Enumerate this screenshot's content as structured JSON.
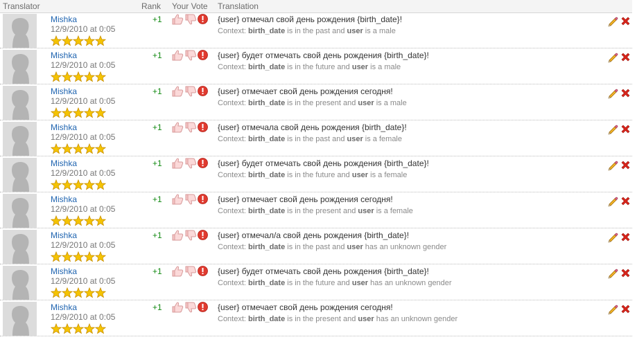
{
  "header": {
    "translator": "Translator",
    "rank": "Rank",
    "your_vote": "Your Vote",
    "translation": "Translation"
  },
  "colors": {
    "link": "#1f64b0",
    "rank": "#138a13",
    "star": "#f5c400",
    "delete": "#d9261c",
    "flag": "#e03a2f"
  },
  "rows": [
    {
      "translator": "Mishka",
      "date": "12/9/2010 at 0:05",
      "stars": 5,
      "rank": "+1",
      "text": "{user} отмечал свой день рождения {birth_date}!",
      "ctx_prefix": "Context: ",
      "ctx_var1": "birth_date",
      "ctx_mid": " is in the past and ",
      "ctx_var2": "user",
      "ctx_suffix": " is a male"
    },
    {
      "translator": "Mishka",
      "date": "12/9/2010 at 0:05",
      "stars": 5,
      "rank": "+1",
      "text": "{user} будет отмечать свой день рождения {birth_date}!",
      "ctx_prefix": "Context: ",
      "ctx_var1": "birth_date",
      "ctx_mid": " is in the future and ",
      "ctx_var2": "user",
      "ctx_suffix": " is a male"
    },
    {
      "translator": "Mishka",
      "date": "12/9/2010 at 0:05",
      "stars": 5,
      "rank": "+1",
      "text": "{user} отмечает свой день рождения сегодня!",
      "ctx_prefix": "Context: ",
      "ctx_var1": "birth_date",
      "ctx_mid": " is in the present and ",
      "ctx_var2": "user",
      "ctx_suffix": " is a male"
    },
    {
      "translator": "Mishka",
      "date": "12/9/2010 at 0:05",
      "stars": 5,
      "rank": "+1",
      "text": "{user} отмечала свой день рождения {birth_date}!",
      "ctx_prefix": "Context: ",
      "ctx_var1": "birth_date",
      "ctx_mid": " is in the past and ",
      "ctx_var2": "user",
      "ctx_suffix": " is a female"
    },
    {
      "translator": "Mishka",
      "date": "12/9/2010 at 0:05",
      "stars": 5,
      "rank": "+1",
      "text": "{user} будет отмечать свой день рождения {birth_date}!",
      "ctx_prefix": "Context: ",
      "ctx_var1": "birth_date",
      "ctx_mid": " is in the future and ",
      "ctx_var2": "user",
      "ctx_suffix": " is a female"
    },
    {
      "translator": "Mishka",
      "date": "12/9/2010 at 0:05",
      "stars": 5,
      "rank": "+1",
      "text": "{user} отмечает свой день рождения сегодня!",
      "ctx_prefix": "Context: ",
      "ctx_var1": "birth_date",
      "ctx_mid": " is in the present and ",
      "ctx_var2": "user",
      "ctx_suffix": " is a female"
    },
    {
      "translator": "Mishka",
      "date": "12/9/2010 at 0:05",
      "stars": 5,
      "rank": "+1",
      "text": "{user} отмечал/а свой день рождения {birth_date}!",
      "ctx_prefix": "Context: ",
      "ctx_var1": "birth_date",
      "ctx_mid": " is in the past and ",
      "ctx_var2": "user",
      "ctx_suffix": " has an unknown gender"
    },
    {
      "translator": "Mishka",
      "date": "12/9/2010 at 0:05",
      "stars": 5,
      "rank": "+1",
      "text": "{user} будет отмечать свой день рождения {birth_date}!",
      "ctx_prefix": "Context: ",
      "ctx_var1": "birth_date",
      "ctx_mid": " is in the future and ",
      "ctx_var2": "user",
      "ctx_suffix": " has an unknown gender"
    },
    {
      "translator": "Mishka",
      "date": "12/9/2010 at 0:05",
      "stars": 5,
      "rank": "+1",
      "text": "{user} отмечает свой день рождения сегодня!",
      "ctx_prefix": "Context: ",
      "ctx_var1": "birth_date",
      "ctx_mid": " is in the present and ",
      "ctx_var2": "user",
      "ctx_suffix": " has an unknown gender"
    }
  ]
}
